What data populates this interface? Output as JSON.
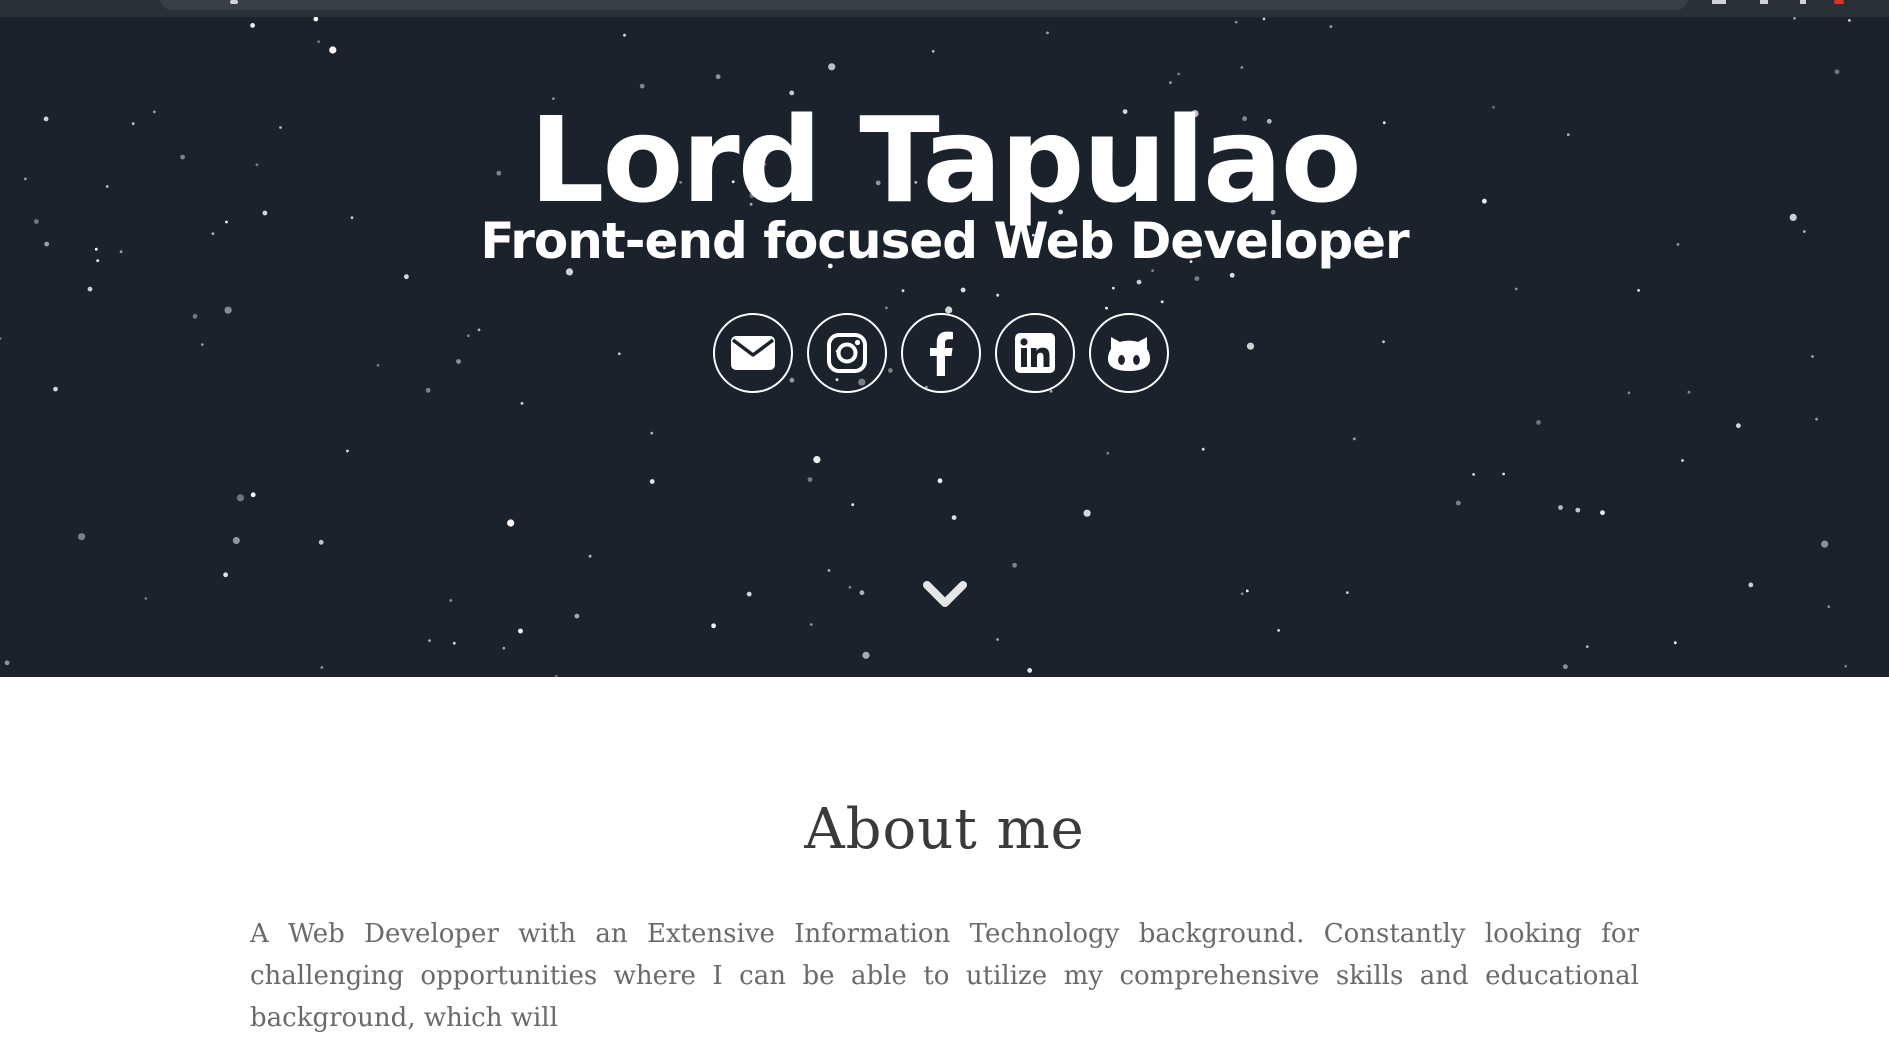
{
  "hero": {
    "name": "Lord Tapulao",
    "tagline": "Front-end focused Web Developer",
    "social_links": [
      {
        "icon": "envelope-icon"
      },
      {
        "icon": "instagram-icon"
      },
      {
        "icon": "facebook-icon"
      },
      {
        "icon": "linkedin-icon"
      },
      {
        "icon": "github-icon"
      }
    ],
    "scroll_icon": "chevron-down-icon"
  },
  "about": {
    "heading": "About me",
    "body": "A Web Developer with an Extensive Information Technology background. Constantly looking for challenging opportunities where I can be able to utilize my comprehensive skills and educational background, which will"
  },
  "colors": {
    "hero_background": "#1c222c",
    "hero_text": "#ffffff",
    "about_heading": "#3a3a3a",
    "about_text": "#6a6a6a"
  }
}
